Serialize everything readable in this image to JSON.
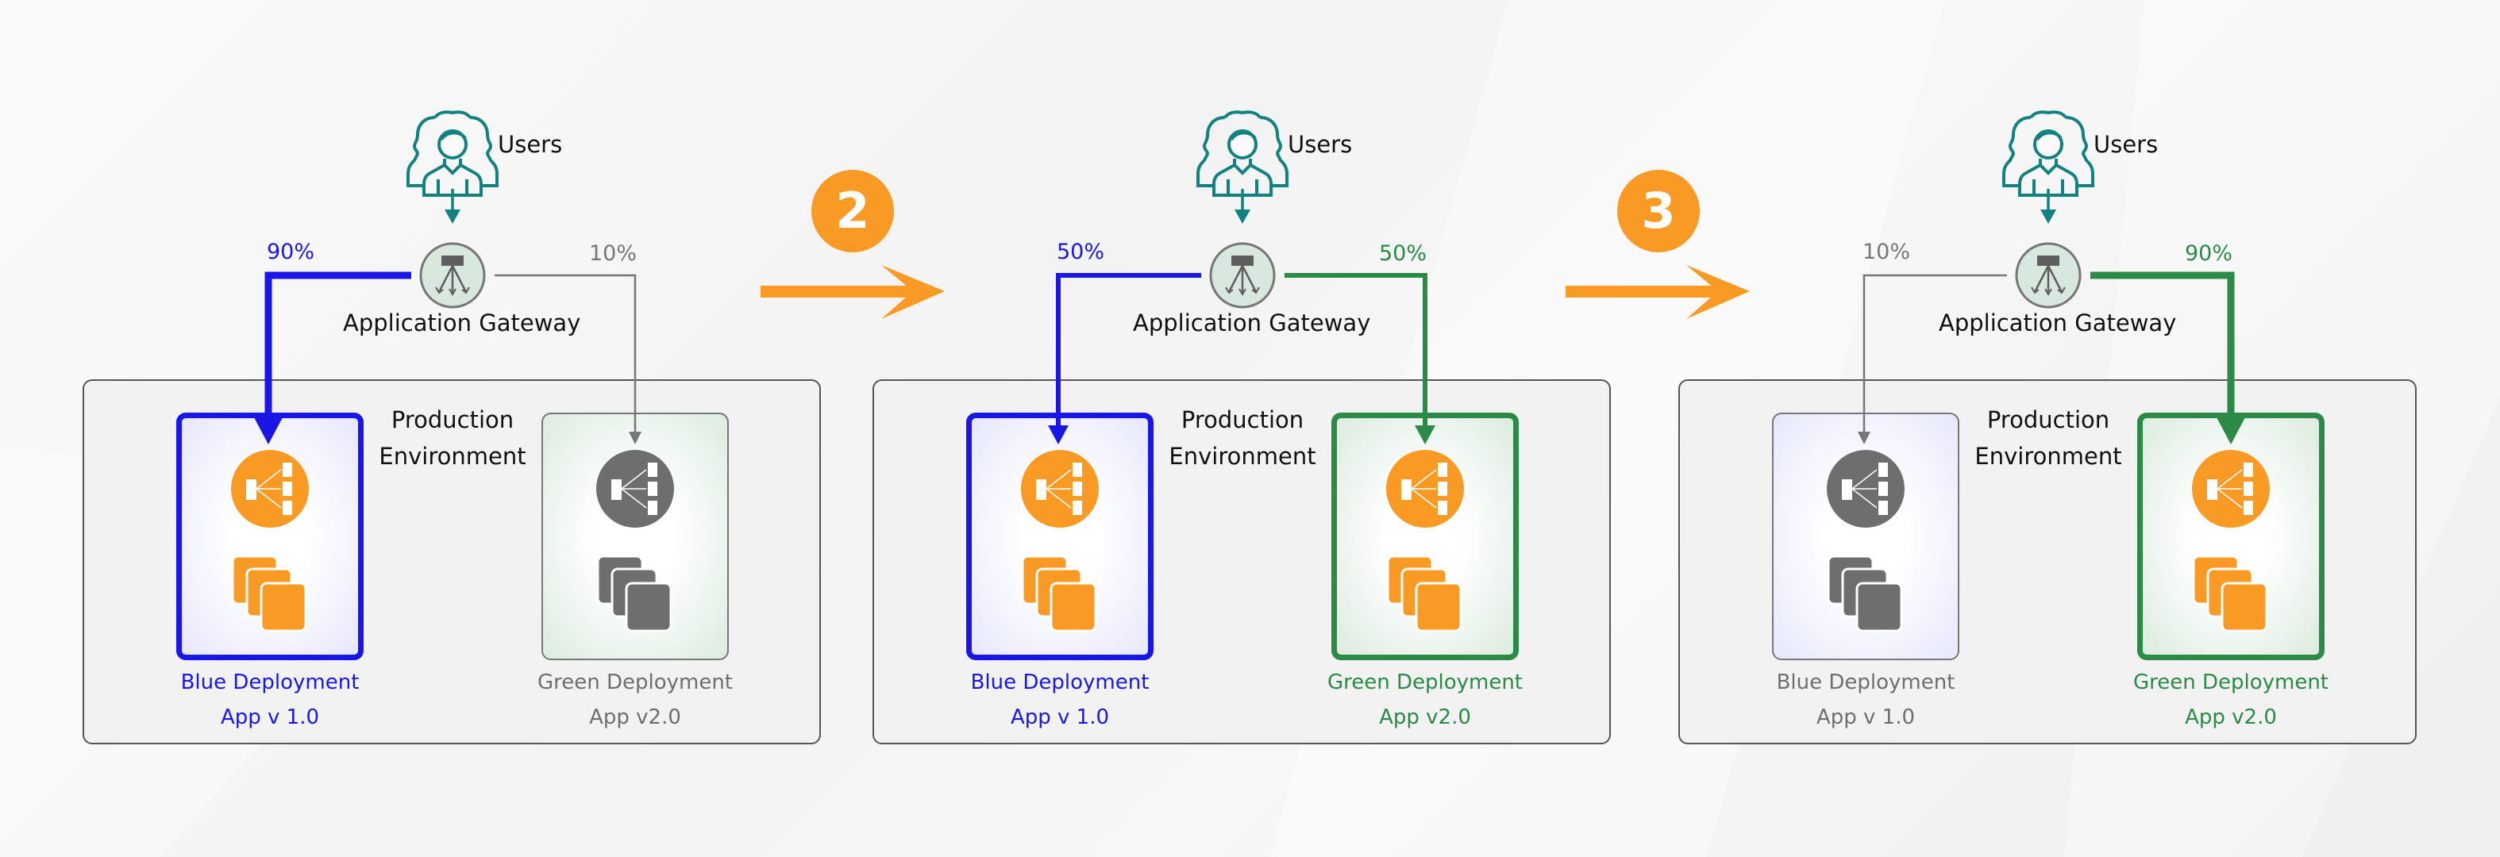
{
  "colors": {
    "blue": "#1a17e6",
    "green": "#2a8a46",
    "gray": "#777777",
    "orange": "#f99a24",
    "teal": "#11827f",
    "gateway_fill": "#d9e8df",
    "icon_gray": "#6e6e6e"
  },
  "steps": [
    {
      "number": "2"
    },
    {
      "number": "3"
    }
  ],
  "panels": [
    {
      "users_label": "Users",
      "gateway_label": "Application Gateway",
      "environment_label_line1": "Production",
      "environment_label_line2": "Environment",
      "blue": {
        "percent": "90%",
        "name": "Blue Deployment",
        "version": "App v 1.0",
        "state": "active"
      },
      "green": {
        "percent": "10%",
        "name": "Green Deployment",
        "version": "App v2.0",
        "state": "inactive"
      }
    },
    {
      "users_label": "Users",
      "gateway_label": "Application Gateway",
      "environment_label_line1": "Production",
      "environment_label_line2": "Environment",
      "blue": {
        "percent": "50%",
        "name": "Blue Deployment",
        "version": "App v 1.0",
        "state": "active"
      },
      "green": {
        "percent": "50%",
        "name": "Green Deployment",
        "version": "App v2.0",
        "state": "active"
      }
    },
    {
      "users_label": "Users",
      "gateway_label": "Application Gateway",
      "environment_label_line1": "Production",
      "environment_label_line2": "Environment",
      "blue": {
        "percent": "10%",
        "name": "Blue Deployment",
        "version": "App v 1.0",
        "state": "inactive"
      },
      "green": {
        "percent": "90%",
        "name": "Green Deployment",
        "version": "App v2.0",
        "state": "active-major"
      }
    }
  ]
}
